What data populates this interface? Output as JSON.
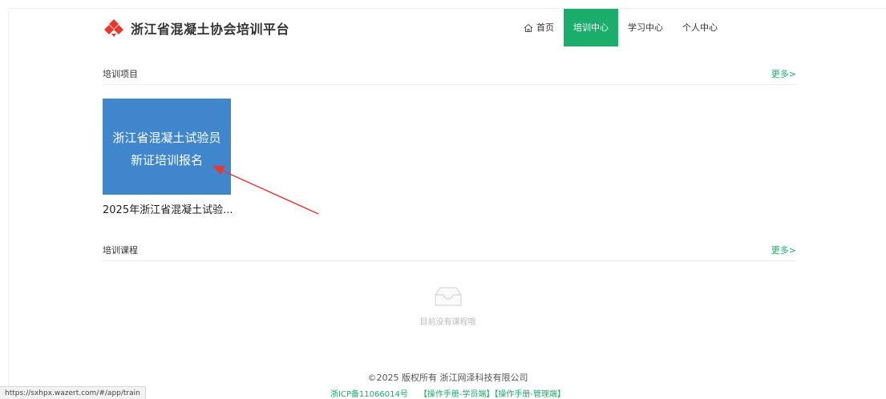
{
  "header": {
    "title": "浙江省混凝土协会培训平台",
    "nav": {
      "home": "首页",
      "training_center": "培训中心",
      "learning_center": "学习中心",
      "personal_center": "个人中心"
    }
  },
  "projects": {
    "title": "培训项目",
    "more": "更多>",
    "card": {
      "line1": "浙江省混凝土试验员",
      "line2": "新证培训报名",
      "caption": "2025年浙江省混凝土试验..."
    }
  },
  "courses": {
    "title": "培训课程",
    "more": "更多>",
    "empty_text": "目前没有课程哦"
  },
  "footer": {
    "copyright": "©2025 版权所有 浙江网泽科技有限公司",
    "icp": "浙ICP备11066014号",
    "manual_student": "【操作手册-学员端】",
    "manual_admin": "【操作手册-管理端】"
  },
  "status_url": "https://sxhpx.wazert.com/#/app/train",
  "colors": {
    "accent": "#1aad6b",
    "card_bg": "#3f86cc",
    "logo": "#e8382b",
    "arrow": "#e53935"
  },
  "icons": [
    "logo-icon",
    "home-icon",
    "empty-box-icon"
  ]
}
